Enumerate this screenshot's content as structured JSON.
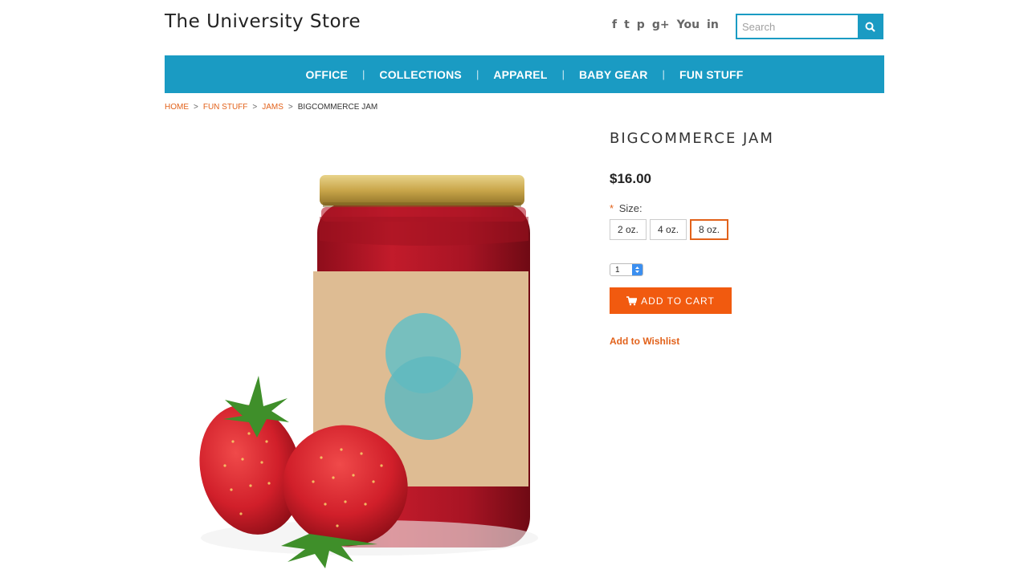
{
  "header": {
    "store_title": "The University Store",
    "social": [
      {
        "icon": "facebook-icon",
        "glyph": "f"
      },
      {
        "icon": "twitter-icon",
        "glyph": "t"
      },
      {
        "icon": "pinterest-icon",
        "glyph": "p"
      },
      {
        "icon": "google-plus-icon",
        "glyph": "g+"
      },
      {
        "icon": "youtube-icon",
        "glyph": "You"
      },
      {
        "icon": "linkedin-icon",
        "glyph": "in"
      }
    ],
    "search_placeholder": "Search"
  },
  "nav": {
    "items": [
      "OFFICE",
      "COLLECTIONS",
      "APPAREL",
      "BABY GEAR",
      "FUN STUFF"
    ]
  },
  "breadcrumb": {
    "home": "HOME",
    "fun_stuff": "FUN STUFF",
    "jams": "JAMS",
    "current": "BIGCOMMERCE JAM",
    "separator": ">"
  },
  "product": {
    "title": "BIGCOMMERCE JAM",
    "price": "$16.00",
    "size_label": "Size:",
    "required_marker": "*",
    "sizes": [
      "2 oz.",
      "4 oz.",
      "8 oz."
    ],
    "selected_size": "8 oz.",
    "quantity": "1",
    "add_to_cart": "ADD TO CART",
    "wishlist": "Add to Wishlist"
  },
  "colors": {
    "accent_blue": "#1a9bc3",
    "accent_orange": "#f15a0f"
  }
}
